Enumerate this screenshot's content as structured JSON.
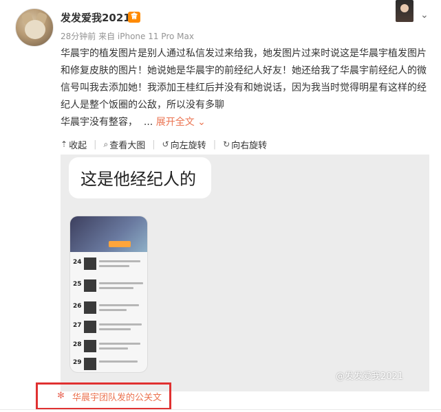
{
  "post": {
    "username": "发发爱我2021",
    "vip_badge": "會",
    "avatar_caption": "",
    "meta": "28分钟前 来自 iPhone 11 Pro Max",
    "deco_sign_text": "",
    "content": "华晨宇的植发图片是别人通过私信发过来给我，她发图片过来时说这是华晨宇植发图片和修复皮肤的图片！她说她是华晨宇的前经纪人好友！她还给我了华晨宇前经纪人的微信号叫我去添加她！我添加王桂红后并没有和她说话，因为我当时觉得明星有这样的经纪人是整个饭圈的公敌，所以没有多聊",
    "content_last": "华晨宇没有整容，",
    "ellipsis": "...",
    "expand_label": "展开全文",
    "expand_icon": "⌄"
  },
  "feed_bar": {
    "collapse": "收起",
    "view_large": "查看大图",
    "rotate_left": "向左旋转",
    "rotate_right": "向右旋转"
  },
  "photo": {
    "bubble_text": "这是他经纪人的",
    "watermark": "@发发爱我2021",
    "rank_numbers": [
      "24",
      "25",
      "26",
      "27",
      "28",
      "29"
    ]
  },
  "team_link": {
    "label": "华晨宇团队发的公关文"
  },
  "icons": {
    "collapse": "collapse-icon",
    "zoom": "zoom-icon",
    "rotate_left": "rotate-left-icon",
    "rotate_right": "rotate-right-icon",
    "menu": "chevron-down-icon",
    "flower": "weibo-flower-icon"
  },
  "colors": {
    "accent": "#eb7350",
    "highlight_box": "#e03131",
    "vip": "#ff8a00"
  }
}
